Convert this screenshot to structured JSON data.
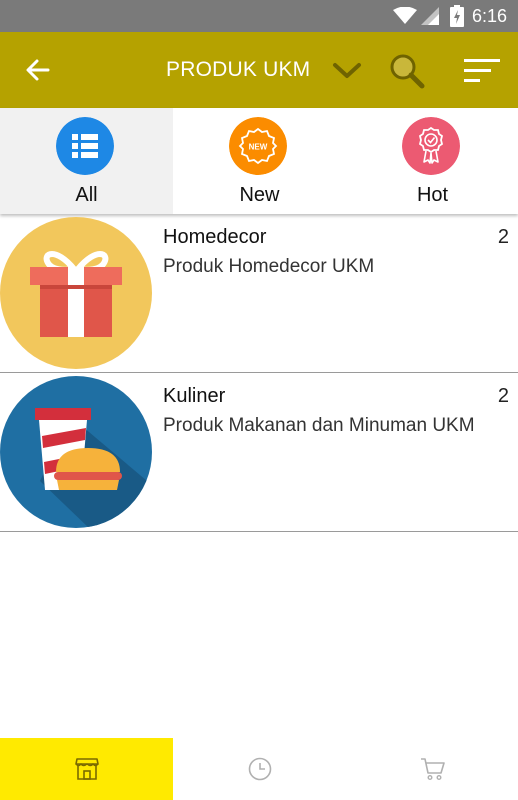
{
  "status_bar": {
    "time": "6:16",
    "icons": [
      "wifi-icon",
      "signal-icon",
      "battery-icon"
    ]
  },
  "app_bar": {
    "title": "PRODUK UKM",
    "background_color": "#b5a200",
    "icons": [
      "back-arrow-icon",
      "chevron-down-icon",
      "search-icon",
      "sort-icon"
    ]
  },
  "tabs": [
    {
      "label": "All",
      "icon": "list-icon",
      "color": "#1e88e5",
      "selected": true
    },
    {
      "label": "New",
      "icon": "new-badge-icon",
      "color": "#fb8c00",
      "selected": false
    },
    {
      "label": "Hot",
      "icon": "award-icon",
      "color": "#ec5a72",
      "selected": false
    }
  ],
  "categories": [
    {
      "name": "Homedecor",
      "count": "2",
      "description": "Produk Homedecor UKM",
      "image": "gift-box-image"
    },
    {
      "name": "Kuliner",
      "count": "2",
      "description": "Produk Makanan dan Minuman UKM",
      "image": "drink-and-burger-image"
    }
  ],
  "bottom_nav": {
    "accent_color": "#ffea00",
    "items": [
      {
        "icon": "store-icon",
        "selected": true
      },
      {
        "icon": "clock-icon",
        "selected": false
      },
      {
        "icon": "cart-icon",
        "selected": false
      }
    ]
  }
}
